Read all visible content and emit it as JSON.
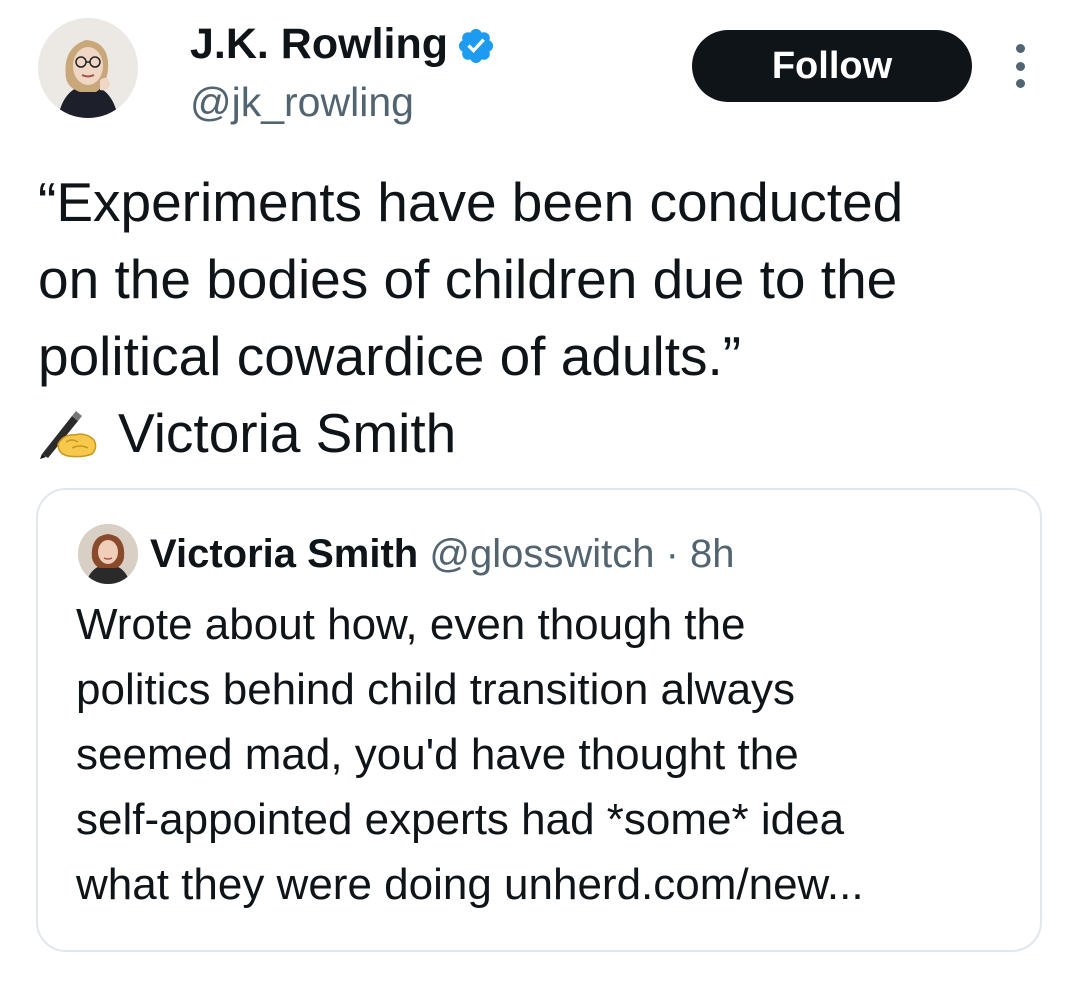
{
  "tweet": {
    "author": {
      "name": "J.K. Rowling",
      "handle": "@jk_rowling",
      "verified": true
    },
    "follow_label": "Follow",
    "text_lines": [
      "“Experiments have been conducted",
      "on the bodies of children due to the",
      "political cowardice of adults.”"
    ],
    "attribution_emoji": "writing-hand-icon",
    "attribution": "Victoria Smith"
  },
  "quote": {
    "author": {
      "name": "Victoria Smith",
      "handle": "@glosswitch"
    },
    "separator": " · ",
    "time": "8h",
    "text_lines": [
      "Wrote about how, even though the",
      "politics behind child transition always",
      "seemed mad, you'd have thought the",
      "self-appointed experts had *some* idea",
      "what they were doing unherd.com/new..."
    ]
  },
  "colors": {
    "text_primary": "#0f1419",
    "text_secondary": "#536471",
    "follow_button_bg": "#0f1419",
    "verified_badge": "#1d9bf0",
    "card_border": "#e1e8ed"
  }
}
